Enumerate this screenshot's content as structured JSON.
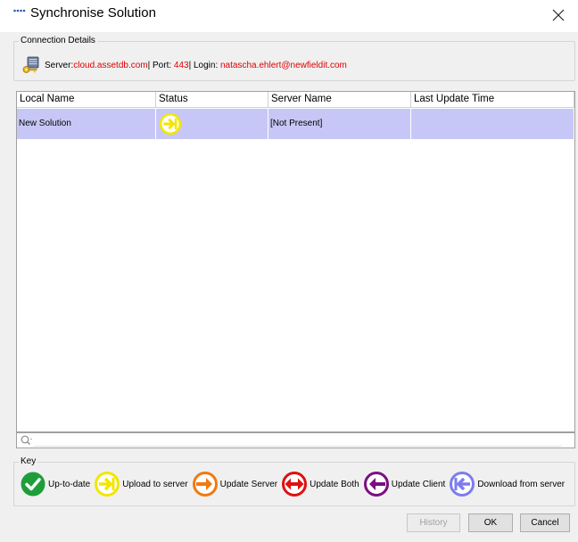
{
  "window": {
    "title": "Synchronise Solution",
    "close_icon": "close-icon",
    "app_icon": "dots-icon"
  },
  "connection": {
    "group_label": "Connection Details",
    "server_label": "Server: ",
    "server_value": "cloud.assetdb.com",
    "port_label": " | Port: ",
    "port_value": "443",
    "login_label": " | Login: ",
    "login_value": "natascha.ehlert@newfieldit.com",
    "icon": "lock-key-icon",
    "value_color": "#e00000"
  },
  "table": {
    "columns": [
      "Local Name",
      "Status",
      "Server Name",
      "Last Update Time"
    ],
    "rows": [
      {
        "local_name": "New Solution",
        "status_icon": "upload-to-server-icon",
        "server_name": "[Not Present]",
        "last_update_time": ""
      }
    ],
    "selected_row_color": "#c7c7f7"
  },
  "search": {
    "icon": "search-icon",
    "value": "",
    "placeholder": ""
  },
  "key": {
    "group_label": "Key",
    "items": [
      {
        "label": "Up-to-date",
        "icon": "checkmark-icon",
        "color": "#1e9e3a"
      },
      {
        "label": "Upload to server",
        "icon": "upload-to-server-icon",
        "color": "#f2e600"
      },
      {
        "label": "Update Server",
        "icon": "update-server-icon",
        "color": "#f07a10"
      },
      {
        "label": "Update Both",
        "icon": "update-both-icon",
        "color": "#e01010"
      },
      {
        "label": "Update Client",
        "icon": "update-client-icon",
        "color": "#7a1080"
      },
      {
        "label": "Download from server",
        "icon": "download-from-server-icon",
        "color": "#7c7cf0"
      }
    ]
  },
  "buttons": {
    "history": "History",
    "ok": "OK",
    "cancel": "Cancel"
  }
}
